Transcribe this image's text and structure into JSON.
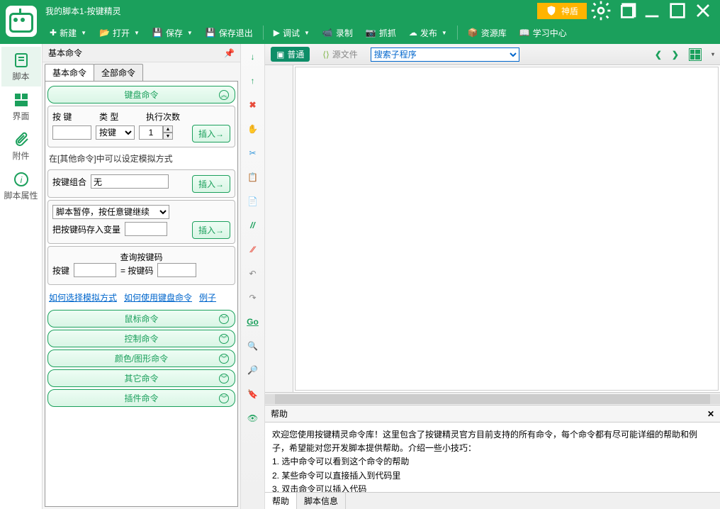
{
  "window": {
    "title": "我的脚本1-按键精灵",
    "shendun": "神盾"
  },
  "toolbar": {
    "new": "新建",
    "open": "打开",
    "save": "保存",
    "save_exit": "保存退出",
    "debug": "调试",
    "record": "录制",
    "grab": "抓抓",
    "publish": "发布",
    "resource": "资源库",
    "learn": "学习中心"
  },
  "left_rail": {
    "script": "脚本",
    "ui": "界面",
    "attach": "附件",
    "props": "脚本属性"
  },
  "cmd_panel": {
    "title": "基本命令",
    "tabs": {
      "basic": "基本命令",
      "all": "全部命令"
    },
    "accordion": {
      "keyboard": "键盘命令",
      "mouse": "鼠标命令",
      "control": "控制命令",
      "color": "颜色/图形命令",
      "other": "其它命令",
      "plugin": "插件命令"
    },
    "kb": {
      "label_key": "按 键",
      "label_type": "类 型",
      "label_count": "执行次数",
      "type_option": "按键",
      "count_value": "1",
      "insert": "插入→",
      "hint1": "在[其他命令]中可以设定模拟方式",
      "combo_label": "按键组合",
      "combo_value": "无",
      "pause_label": "脚本暂停，按任意键继续",
      "save_var": "把按键码存入变量",
      "query_title": "查询按键码",
      "query_key": "按键",
      "query_eq": "= 按键码"
    },
    "links": {
      "l1": "如何选择模拟方式",
      "l2": "如何使用键盘命令",
      "l3": "例子"
    }
  },
  "code_toolbar": {
    "normal": "普通",
    "source": "源文件",
    "search_placeholder": "搜索子程序"
  },
  "help": {
    "title": "帮助",
    "body1": "欢迎您使用按键精灵命令库！这里包含了按键精灵官方目前支持的所有命令，每个命令都有尽可能详细的帮助和例子，希望能对您开发脚本提供帮助。介绍一些小技巧：",
    "li1": "1. 选中命令可以看到这个命令的帮助",
    "li2": "2. 某些命令可以直接插入到代码里",
    "li3": "3. 双击命令可以插入代码",
    "tab_help": "帮助",
    "tab_info": "脚本信息"
  },
  "icon_rail_go": "Go"
}
